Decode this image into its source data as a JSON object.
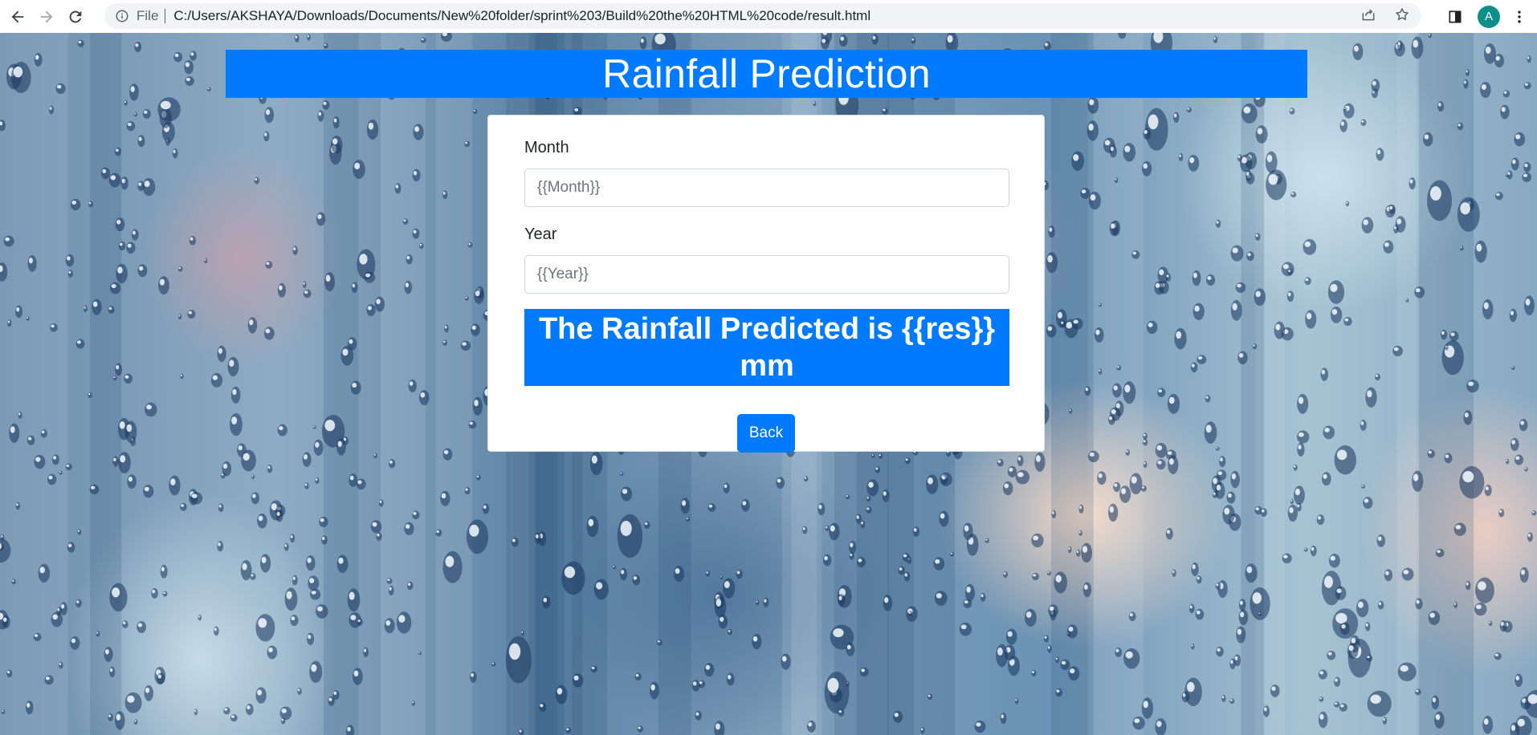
{
  "browser": {
    "scheme_label": "File",
    "url": "C:/Users/AKSHAYA/Downloads/Documents/New%20folder/sprint%203/Build%20the%20HTML%20code/result.html",
    "avatar_letter": "A",
    "icons": [
      "back-arrow-icon",
      "forward-arrow-icon",
      "reload-icon",
      "info-icon",
      "share-icon",
      "star-icon",
      "side-panel-icon",
      "menu-dots-icon"
    ]
  },
  "page": {
    "title": "Rainfall Prediction",
    "form": {
      "month_label": "Month",
      "month_value": "{{Month}}",
      "year_label": "Year",
      "year_value": "{{Year}}"
    },
    "result_text": "The Rainfall Predicted is {{res}} mm",
    "back_label": "Back"
  },
  "colors": {
    "primary": "#007bff",
    "avatar": "#0b8f8a"
  }
}
